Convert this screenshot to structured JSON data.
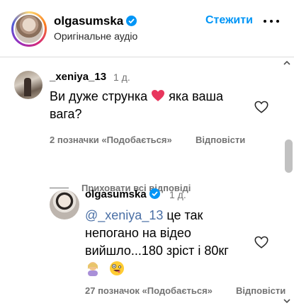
{
  "header": {
    "username": "olgasumska",
    "subtitle": "Оригінальне аудіо",
    "follow_label": "Стежити"
  },
  "comment": {
    "username": "_xeniya_13",
    "time": "1 д.",
    "text_before_emoji": "Ви дуже струнка",
    "text_after_emoji": " яка ваша вага?",
    "likes": "2 позначки «Подобається»",
    "reply_label": "Відповісти"
  },
  "replies_toggle": {
    "label": "Приховати всі відповіді"
  },
  "reply": {
    "username": "olgasumska",
    "time": "1 д.",
    "mention": "@_xeniya_13",
    "text": " це так непогано на відео вийшло...180 зріст і 80кг",
    "likes": "27 позначок «Подобається»",
    "reply_label": "Відповісти"
  },
  "colors": {
    "accent": "#0095f6",
    "secondary_text": "#737373",
    "mention": "#4a6fa5"
  },
  "icons": [
    "verified-icon",
    "more-options-icon",
    "heart-icon",
    "heart-emoji-icon",
    "woman-gesturing-emoji-icon",
    "zany-face-emoji-icon"
  ]
}
